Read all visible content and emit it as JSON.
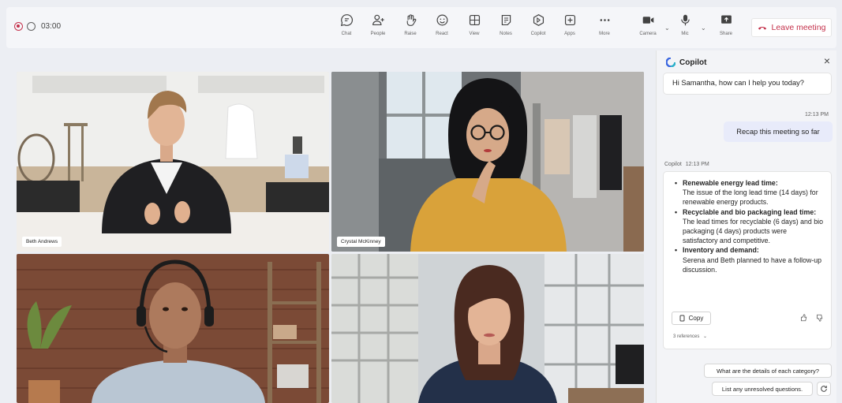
{
  "toolbar": {
    "timer": "03:00",
    "buttons": [
      {
        "label": "Chat",
        "icon": "chat-icon"
      },
      {
        "label": "People",
        "icon": "people-icon"
      },
      {
        "label": "Raise",
        "icon": "raise-hand-icon"
      },
      {
        "label": "React",
        "icon": "react-icon"
      },
      {
        "label": "View",
        "icon": "view-icon"
      },
      {
        "label": "Notes",
        "icon": "notes-icon"
      },
      {
        "label": "Copilot",
        "icon": "copilot-icon"
      },
      {
        "label": "Apps",
        "icon": "apps-icon"
      },
      {
        "label": "More",
        "icon": "more-icon"
      },
      {
        "label": "Camera",
        "icon": "camera-icon"
      },
      {
        "label": "Mic",
        "icon": "mic-icon"
      },
      {
        "label": "Share",
        "icon": "share-icon"
      }
    ],
    "leave_label": "Leave meeting",
    "leave_color": "#c4314b"
  },
  "participants": [
    {
      "name": "Beth Andrews"
    },
    {
      "name": "Crystal McKinney"
    },
    {
      "name": ""
    },
    {
      "name": ""
    }
  ],
  "copilot": {
    "title": "Copilot",
    "greeting": "Hi Samantha, how can I help you today?",
    "user_time": "12:13 PM",
    "user_message": "Recap this meeting so far",
    "reply_sender": "Copilot",
    "reply_time": "12:13 PM",
    "summary": [
      {
        "heading": "Renewable energy lead time:",
        "body": "The issue of the long lead time (14 days) for renewable energy products."
      },
      {
        "heading": "Recyclable and bio packaging lead time:",
        "body": "The lead times for recyclable (6 days) and bio packaging (4 days) products were satisfactory and competitive."
      },
      {
        "heading": "Inventory and demand:",
        "body": "Serena and Beth planned to have a follow-up discussion."
      }
    ],
    "copy_label": "Copy",
    "references_label": "3 references",
    "suggestions": [
      "What are the details of each category?",
      "List any unresolved questions."
    ]
  }
}
